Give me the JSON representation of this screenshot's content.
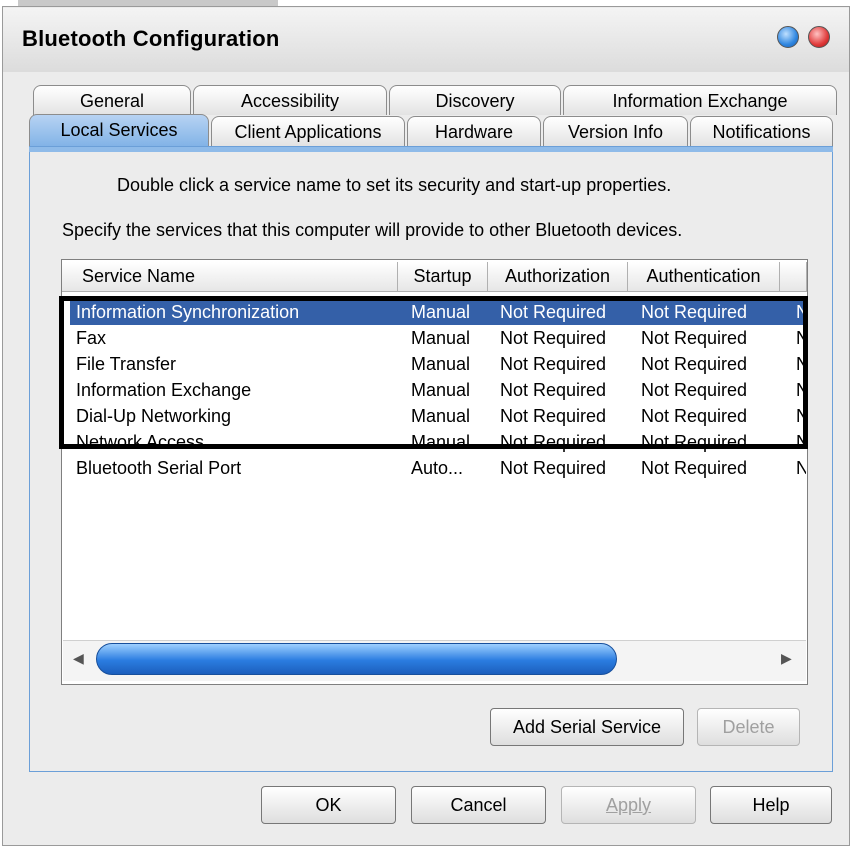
{
  "window": {
    "title": "Bluetooth Configuration"
  },
  "tabs_row1": [
    "General",
    "Accessibility",
    "Discovery",
    "Information Exchange"
  ],
  "tabs_row2": [
    "Local Services",
    "Client Applications",
    "Hardware",
    "Version Info",
    "Notifications"
  ],
  "active_tab": "Local Services",
  "instructions": {
    "line1": "Double click a service name to set its security and start-up properties.",
    "line2": "Specify the services that this computer will provide to other Bluetooth devices."
  },
  "services_table": {
    "columns": [
      "Service Name",
      "Startup",
      "Authorization",
      "Authentication"
    ],
    "rows": [
      {
        "name": "Information Synchronization",
        "startup": "Manual",
        "authorization": "Not Required",
        "authentication": "Not Required",
        "extra": "N",
        "selected": true
      },
      {
        "name": "Fax",
        "startup": "Manual",
        "authorization": "Not Required",
        "authentication": "Not Required",
        "extra": "N",
        "selected": false
      },
      {
        "name": "File Transfer",
        "startup": "Manual",
        "authorization": "Not Required",
        "authentication": "Not Required",
        "extra": "N",
        "selected": false
      },
      {
        "name": "Information Exchange",
        "startup": "Manual",
        "authorization": "Not Required",
        "authentication": "Not Required",
        "extra": "N",
        "selected": false
      },
      {
        "name": "Dial-Up Networking",
        "startup": "Manual",
        "authorization": "Not Required",
        "authentication": "Not Required",
        "extra": "N",
        "selected": false
      },
      {
        "name": "Network Access",
        "startup": "Manual",
        "authorization": "Not Required",
        "authentication": "Not Required",
        "extra": "N",
        "selected": false
      },
      {
        "name": "Bluetooth Serial Port",
        "startup": "Auto...",
        "authorization": "Not Required",
        "authentication": "Not Required",
        "extra": "N",
        "selected": false
      }
    ]
  },
  "scrollbar": {
    "left_arrow": "◀",
    "right_arrow": "▶"
  },
  "panel_buttons": {
    "add_serial_service": "Add Serial Service",
    "delete": "Delete"
  },
  "dialog_buttons": {
    "ok": "OK",
    "cancel": "Cancel",
    "apply": "Apply",
    "help": "Help"
  },
  "colors": {
    "selection": "#3460a8",
    "active_tab": "#7fb1e6",
    "highlight_border": "#000000"
  }
}
